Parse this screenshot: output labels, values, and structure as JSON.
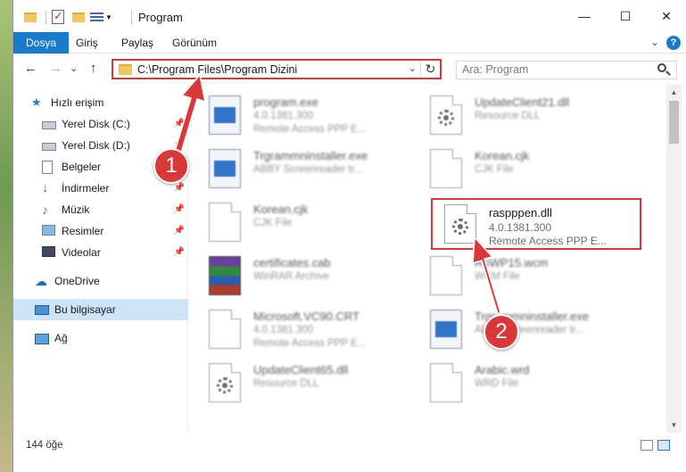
{
  "window": {
    "title": "Program",
    "minimize": "—",
    "maximize": "☐",
    "close": "✕"
  },
  "ribbon": {
    "tabs": [
      "Dosya",
      "Giriş",
      "Paylaş",
      "Görünüm"
    ],
    "help": "?",
    "chevron": "⌄"
  },
  "nav": {
    "back": "←",
    "forward": "→",
    "dropdown": "⌄",
    "up": "↑",
    "address_path": "C:\\Program Files\\Program Dizini",
    "address_dropdown": "⌄",
    "refresh": "↻",
    "search_placeholder": "Ara: Program"
  },
  "sidebar": {
    "items": [
      {
        "label": "Hızlı erişim",
        "icon": "star-icon",
        "pinned": false
      },
      {
        "label": "Yerel Disk (C:)",
        "icon": "drive-icon",
        "pinned": true
      },
      {
        "label": "Yerel Disk (D:)",
        "icon": "drive-icon",
        "pinned": true
      },
      {
        "label": "Belgeler",
        "icon": "documents-icon",
        "pinned": true
      },
      {
        "label": "İndirmeler",
        "icon": "downloads-icon",
        "pinned": true
      },
      {
        "label": "Müzik",
        "icon": "music-icon",
        "pinned": true
      },
      {
        "label": "Resimler",
        "icon": "pictures-icon",
        "pinned": true
      },
      {
        "label": "Videolar",
        "icon": "videos-icon",
        "pinned": true
      },
      {
        "label": "OneDrive",
        "icon": "onedrive-icon",
        "pinned": false
      },
      {
        "label": "Bu bilgisayar",
        "icon": "this-pc-icon",
        "pinned": false
      },
      {
        "label": "Ağ",
        "icon": "network-icon",
        "pinned": false
      }
    ]
  },
  "files": [
    {
      "name": "program.exe",
      "version": "4.0.1381.300",
      "desc": "Remote Access PPP E...",
      "type": "exe"
    },
    {
      "name": "UpdateClient21.dll",
      "version": "Resource DLL",
      "desc": "",
      "type": "dll"
    },
    {
      "name": "Trgrammninstaller.exe",
      "version": "ABBY Screenreader tr...",
      "desc": "",
      "type": "exe"
    },
    {
      "name": "Korean.cjk",
      "version": "CJK File",
      "desc": "",
      "type": "doc"
    },
    {
      "name": "Korean.cjk",
      "version": "CJK File",
      "desc": "",
      "type": "doc"
    },
    {
      "name": "raspppen.dll",
      "version": "4.0.1381.300",
      "desc": "Remote Access PPP E...",
      "type": "dll"
    },
    {
      "name": "certificates.cab",
      "version": "WinRAR Archive",
      "desc": "",
      "type": "rar"
    },
    {
      "name": "RoWP15.wcm",
      "version": "WCM File",
      "desc": "",
      "type": "doc"
    },
    {
      "name": "Microsoft.VC90.CRT",
      "version": "4.0.1381.300",
      "desc": "Remote Access PPP E...",
      "type": "doc"
    },
    {
      "name": "Trgrammninstaller.exe",
      "version": "ABBY Screenreader tr...",
      "desc": "",
      "type": "exe"
    },
    {
      "name": "UpdateClient65.dll",
      "version": "Resource DLL",
      "desc": "",
      "type": "dll"
    },
    {
      "name": "Arabic.wrd",
      "version": "WRD File",
      "desc": "",
      "type": "doc"
    }
  ],
  "status": {
    "item_count": "144 öğe"
  },
  "annotations": {
    "step1": "1",
    "step2": "2",
    "color": "#d93838"
  }
}
